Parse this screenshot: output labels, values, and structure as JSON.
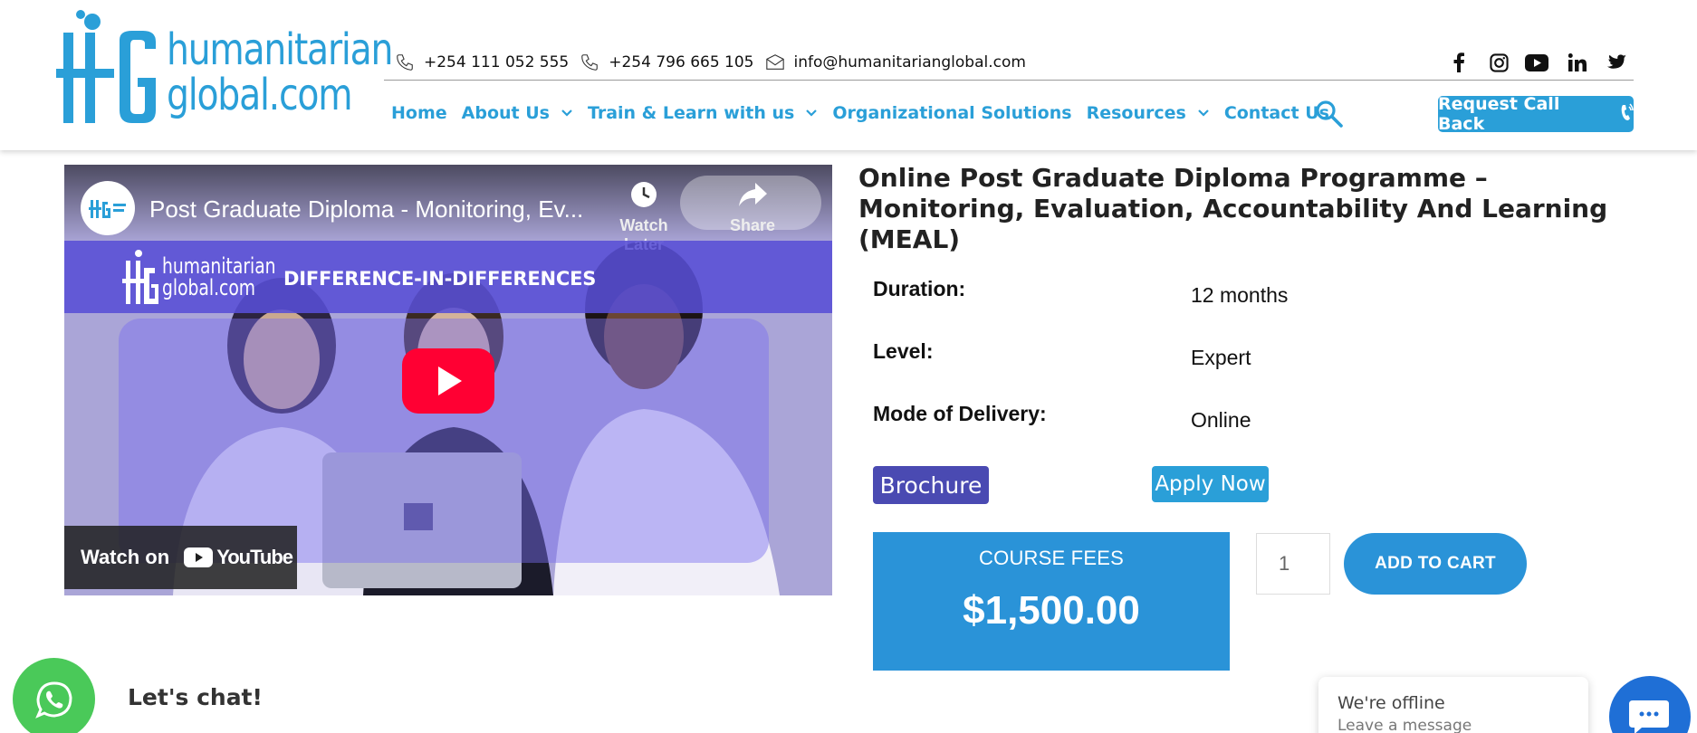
{
  "header": {
    "logo_text_line1": "humanitarian",
    "logo_text_line2": "global.com",
    "contact": {
      "phone1": "+254 111 052 555",
      "phone2": "+254 796 665 105",
      "email": "info@humanitarianglobal.com"
    },
    "social_icons": [
      "facebook-icon",
      "instagram-icon",
      "youtube-icon",
      "linkedin-icon",
      "twitter-icon"
    ],
    "nav": [
      {
        "label": "Home",
        "has_dropdown": false
      },
      {
        "label": "About Us",
        "has_dropdown": true
      },
      {
        "label": "Train & Learn with us",
        "has_dropdown": true
      },
      {
        "label": "Organizational Solutions",
        "has_dropdown": false
      },
      {
        "label": "Resources",
        "has_dropdown": true
      },
      {
        "label": "Contact Us",
        "has_dropdown": false
      }
    ],
    "callback_label": "Request Call Back"
  },
  "video": {
    "title": "Post Graduate Diploma - Monitoring, Ev...",
    "watch_later": "Watch Later",
    "share": "Share",
    "banner_text": "DIFFERENCE-IN-DIFFERENCES",
    "banner_logo_line1": "humanitarian",
    "banner_logo_line2": "global.com",
    "watch_on": "Watch on",
    "youtube_label": "YouTube"
  },
  "course": {
    "title": "Online Post Graduate Diploma Programme – Monitoring, Evaluation, Accountability And Learning (MEAL)",
    "details": [
      {
        "label": "Duration:",
        "value": "12 months"
      },
      {
        "label": "Level:",
        "value": "Expert"
      },
      {
        "label": "Mode of Delivery:",
        "value": "Online"
      }
    ],
    "brochure_label": "Brochure",
    "apply_label": "Apply Now",
    "fees_label": "COURSE FEES",
    "fees_value": "$1,500.00",
    "quantity": "1",
    "add_to_cart_label": "ADD TO CART"
  },
  "chat": {
    "lets_chat": "Let's chat!",
    "offline_title": "We're offline",
    "offline_sub": "Leave a message"
  },
  "colors": {
    "brand_blue": "#2a9fd8",
    "fees_blue": "#2a93d8",
    "brochure_purple": "#4a4ab2",
    "whatsapp_green": "#4ac959",
    "chat_blue": "#1f6fd6"
  }
}
